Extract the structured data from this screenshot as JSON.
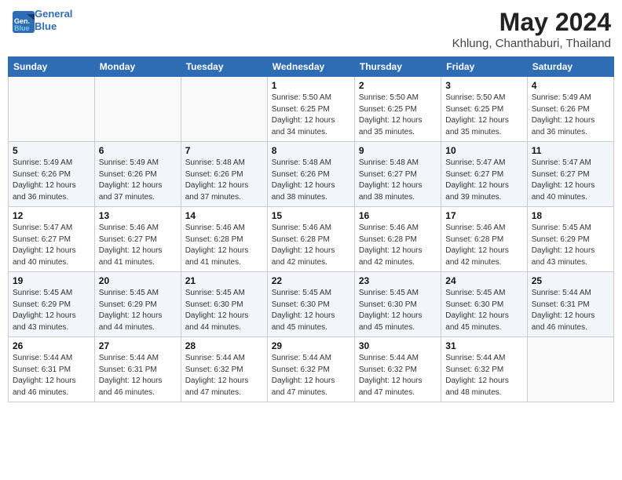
{
  "header": {
    "logo_line1": "General",
    "logo_line2": "Blue",
    "title": "May 2024",
    "subtitle": "Khlung, Chanthaburi, Thailand"
  },
  "days_of_week": [
    "Sunday",
    "Monday",
    "Tuesday",
    "Wednesday",
    "Thursday",
    "Friday",
    "Saturday"
  ],
  "weeks": [
    [
      {
        "day": "",
        "detail": ""
      },
      {
        "day": "",
        "detail": ""
      },
      {
        "day": "",
        "detail": ""
      },
      {
        "day": "1",
        "detail": "Sunrise: 5:50 AM\nSunset: 6:25 PM\nDaylight: 12 hours\nand 34 minutes."
      },
      {
        "day": "2",
        "detail": "Sunrise: 5:50 AM\nSunset: 6:25 PM\nDaylight: 12 hours\nand 35 minutes."
      },
      {
        "day": "3",
        "detail": "Sunrise: 5:50 AM\nSunset: 6:25 PM\nDaylight: 12 hours\nand 35 minutes."
      },
      {
        "day": "4",
        "detail": "Sunrise: 5:49 AM\nSunset: 6:26 PM\nDaylight: 12 hours\nand 36 minutes."
      }
    ],
    [
      {
        "day": "5",
        "detail": "Sunrise: 5:49 AM\nSunset: 6:26 PM\nDaylight: 12 hours\nand 36 minutes."
      },
      {
        "day": "6",
        "detail": "Sunrise: 5:49 AM\nSunset: 6:26 PM\nDaylight: 12 hours\nand 37 minutes."
      },
      {
        "day": "7",
        "detail": "Sunrise: 5:48 AM\nSunset: 6:26 PM\nDaylight: 12 hours\nand 37 minutes."
      },
      {
        "day": "8",
        "detail": "Sunrise: 5:48 AM\nSunset: 6:26 PM\nDaylight: 12 hours\nand 38 minutes."
      },
      {
        "day": "9",
        "detail": "Sunrise: 5:48 AM\nSunset: 6:27 PM\nDaylight: 12 hours\nand 38 minutes."
      },
      {
        "day": "10",
        "detail": "Sunrise: 5:47 AM\nSunset: 6:27 PM\nDaylight: 12 hours\nand 39 minutes."
      },
      {
        "day": "11",
        "detail": "Sunrise: 5:47 AM\nSunset: 6:27 PM\nDaylight: 12 hours\nand 40 minutes."
      }
    ],
    [
      {
        "day": "12",
        "detail": "Sunrise: 5:47 AM\nSunset: 6:27 PM\nDaylight: 12 hours\nand 40 minutes."
      },
      {
        "day": "13",
        "detail": "Sunrise: 5:46 AM\nSunset: 6:27 PM\nDaylight: 12 hours\nand 41 minutes."
      },
      {
        "day": "14",
        "detail": "Sunrise: 5:46 AM\nSunset: 6:28 PM\nDaylight: 12 hours\nand 41 minutes."
      },
      {
        "day": "15",
        "detail": "Sunrise: 5:46 AM\nSunset: 6:28 PM\nDaylight: 12 hours\nand 42 minutes."
      },
      {
        "day": "16",
        "detail": "Sunrise: 5:46 AM\nSunset: 6:28 PM\nDaylight: 12 hours\nand 42 minutes."
      },
      {
        "day": "17",
        "detail": "Sunrise: 5:46 AM\nSunset: 6:28 PM\nDaylight: 12 hours\nand 42 minutes."
      },
      {
        "day": "18",
        "detail": "Sunrise: 5:45 AM\nSunset: 6:29 PM\nDaylight: 12 hours\nand 43 minutes."
      }
    ],
    [
      {
        "day": "19",
        "detail": "Sunrise: 5:45 AM\nSunset: 6:29 PM\nDaylight: 12 hours\nand 43 minutes."
      },
      {
        "day": "20",
        "detail": "Sunrise: 5:45 AM\nSunset: 6:29 PM\nDaylight: 12 hours\nand 44 minutes."
      },
      {
        "day": "21",
        "detail": "Sunrise: 5:45 AM\nSunset: 6:30 PM\nDaylight: 12 hours\nand 44 minutes."
      },
      {
        "day": "22",
        "detail": "Sunrise: 5:45 AM\nSunset: 6:30 PM\nDaylight: 12 hours\nand 45 minutes."
      },
      {
        "day": "23",
        "detail": "Sunrise: 5:45 AM\nSunset: 6:30 PM\nDaylight: 12 hours\nand 45 minutes."
      },
      {
        "day": "24",
        "detail": "Sunrise: 5:45 AM\nSunset: 6:30 PM\nDaylight: 12 hours\nand 45 minutes."
      },
      {
        "day": "25",
        "detail": "Sunrise: 5:44 AM\nSunset: 6:31 PM\nDaylight: 12 hours\nand 46 minutes."
      }
    ],
    [
      {
        "day": "26",
        "detail": "Sunrise: 5:44 AM\nSunset: 6:31 PM\nDaylight: 12 hours\nand 46 minutes."
      },
      {
        "day": "27",
        "detail": "Sunrise: 5:44 AM\nSunset: 6:31 PM\nDaylight: 12 hours\nand 46 minutes."
      },
      {
        "day": "28",
        "detail": "Sunrise: 5:44 AM\nSunset: 6:32 PM\nDaylight: 12 hours\nand 47 minutes."
      },
      {
        "day": "29",
        "detail": "Sunrise: 5:44 AM\nSunset: 6:32 PM\nDaylight: 12 hours\nand 47 minutes."
      },
      {
        "day": "30",
        "detail": "Sunrise: 5:44 AM\nSunset: 6:32 PM\nDaylight: 12 hours\nand 47 minutes."
      },
      {
        "day": "31",
        "detail": "Sunrise: 5:44 AM\nSunset: 6:32 PM\nDaylight: 12 hours\nand 48 minutes."
      },
      {
        "day": "",
        "detail": ""
      }
    ]
  ]
}
